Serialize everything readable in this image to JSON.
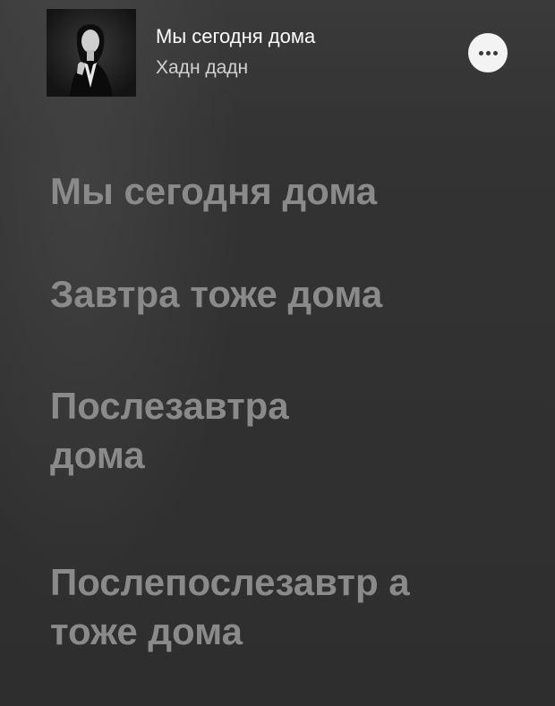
{
  "now_playing": {
    "title": "Мы сегодня дома",
    "artist": "Хадн дадн",
    "artwork_icon": "album-artwork-portrait",
    "more_icon": "ellipsis-icon"
  },
  "lyrics": {
    "lines": [
      "Мы сегодня дома",
      "Завтра тоже дома",
      "Послезавтра дома",
      "Послепослезавтр а тоже дома"
    ]
  },
  "colors": {
    "background": "#2f2f2f",
    "lyric_text": "#8a8a8a",
    "title_text": "#ffffff",
    "artist_text": "#d2d2d2",
    "more_button_bg": "#f3f3f3"
  }
}
